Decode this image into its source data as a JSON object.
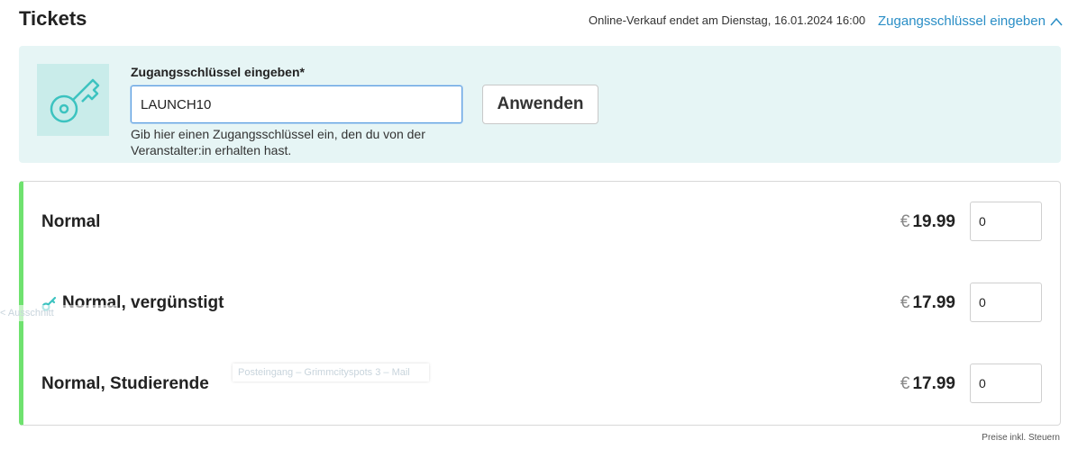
{
  "header": {
    "title": "Tickets",
    "sale_end": "Online-Verkauf endet am Dienstag, 16.01.2024 16:00",
    "key_toggle_label": "Zugangsschlüssel eingeben"
  },
  "key_form": {
    "label": "Zugangsschlüssel eingeben*",
    "value": "LAUNCH10",
    "apply_label": "Anwenden",
    "help": "Gib hier einen Zugangsschlüssel ein, den du von der Veranstalter:in erhalten hast."
  },
  "tickets": [
    {
      "name": "Normal",
      "currency": "€",
      "price": "19.99",
      "qty": "0",
      "key_icon": false
    },
    {
      "name": "Normal, vergünstigt",
      "currency": "€",
      "price": "17.99",
      "qty": "0",
      "key_icon": true
    },
    {
      "name": "Normal, Studierende",
      "currency": "€",
      "price": "17.99",
      "qty": "0",
      "key_icon": false
    }
  ],
  "ghost_labels": {
    "left": "< Ausschnitt",
    "tooltip": "Posteingang – Grimmcityspots 3 – Mail"
  },
  "footer": {
    "tax_note": "Preise inkl. Steuern"
  },
  "colors": {
    "accent": "#2a8ec6",
    "panel_bg": "#e6f5f5",
    "teal": "#3cc3c0",
    "ticket_bar": "#6fe26f"
  }
}
